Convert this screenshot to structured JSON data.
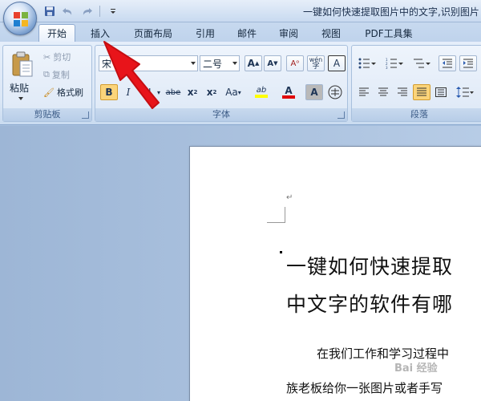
{
  "window": {
    "title": "一键如何快速提取图片中的文字,识别图片",
    "quick_access": [
      "save-icon",
      "undo-icon",
      "redo-icon",
      "customize-icon"
    ]
  },
  "tabs": [
    {
      "label": "开始",
      "active": true
    },
    {
      "label": "插入",
      "active": false
    },
    {
      "label": "页面布局",
      "active": false
    },
    {
      "label": "引用",
      "active": false
    },
    {
      "label": "邮件",
      "active": false
    },
    {
      "label": "审阅",
      "active": false
    },
    {
      "label": "视图",
      "active": false
    },
    {
      "label": "PDF工具集",
      "active": false
    }
  ],
  "clipboard": {
    "group_label": "剪贴板",
    "paste_label": "粘贴",
    "cut_label": "剪切",
    "copy_label": "复制",
    "format_painter_label": "格式刷"
  },
  "font": {
    "group_label": "字体",
    "font_name": "宋",
    "font_size": "二号",
    "grow_label": "A",
    "shrink_label": "A",
    "phonetic_label": "wén",
    "phonetic_top": "ab",
    "border_char": "A",
    "bold_label": "B",
    "italic_label": "I",
    "strike_label": "abe",
    "sub_label": "x",
    "sup_label": "x",
    "case_label": "Aa",
    "highlight_label": "ab",
    "color_label": "A",
    "shade_char": "A",
    "enclose_char": "字",
    "highlight_color": "#ffff00",
    "font_color": "#e00000"
  },
  "paragraph": {
    "group_label": "段落"
  },
  "document": {
    "paragraph_mark": "↵",
    "title_line1": "一键如何快速提取",
    "title_line2": "中文字的软件有哪",
    "body_line1": "在我们工作和学习过程中",
    "body_line2": "族老板给你一张图片或者手写"
  },
  "watermark": "Bai 经验",
  "accent_colors": {
    "arrow": "#e8141a"
  }
}
